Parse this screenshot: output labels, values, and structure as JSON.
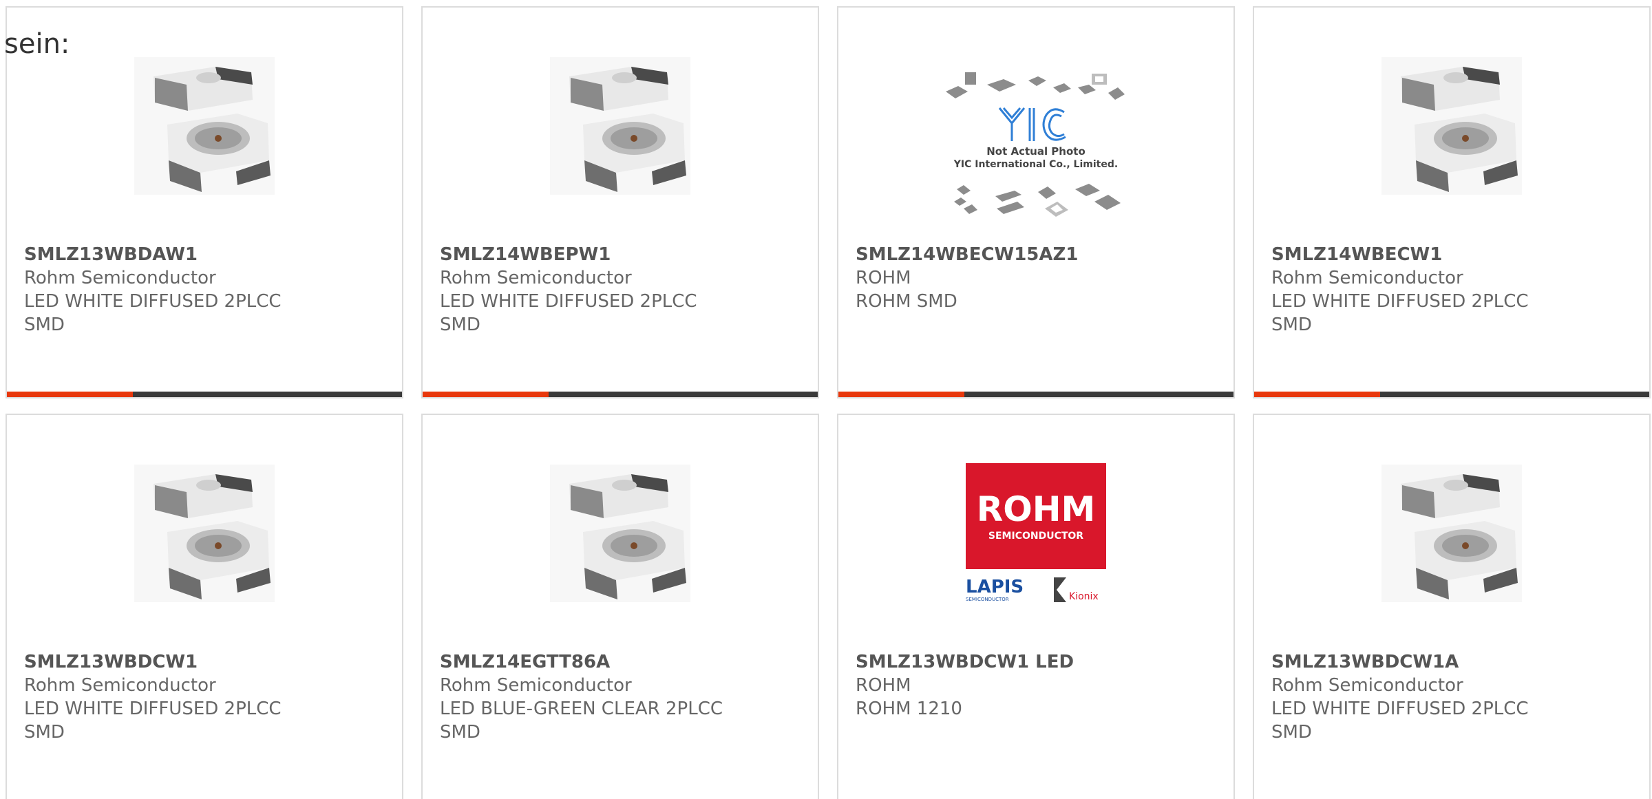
{
  "intro": {
    "text": "sein:"
  },
  "colors": {
    "accent": "#e8380d",
    "bar_dark": "#3a3a3a",
    "rohm_red": "#d9172b",
    "lapis_blue": "#1a4fa0",
    "yic_blue": "#2f7fd6"
  },
  "cards": [
    {
      "part": "SMLZ13WBDAW1",
      "maker": "Rohm Semiconductor",
      "desc1": "LED WHITE DIFFUSED 2PLCC",
      "desc2": "SMD",
      "image": "led-package-image"
    },
    {
      "part": "SMLZ14WBEPW1",
      "maker": "Rohm Semiconductor",
      "desc1": "LED WHITE DIFFUSED 2PLCC",
      "desc2": "SMD",
      "image": "led-package-image"
    },
    {
      "part": "SMLZ14WBECW15AZ1",
      "maker": "ROHM",
      "desc1": "ROHM SMD",
      "desc2": "",
      "image": "yic-placeholder-image",
      "yic_caption1": "Not Actual Photo",
      "yic_caption2": "YIC International Co., Limited.",
      "yic_logo": "YIC"
    },
    {
      "part": "SMLZ14WBECW1",
      "maker": "Rohm Semiconductor",
      "desc1": "LED WHITE DIFFUSED 2PLCC",
      "desc2": "SMD",
      "image": "led-package-image"
    },
    {
      "part": "SMLZ13WBDCW1",
      "maker": "Rohm Semiconductor",
      "desc1": "LED WHITE DIFFUSED 2PLCC",
      "desc2": "SMD",
      "image": "led-package-image"
    },
    {
      "part": "SMLZ14EGTT86A",
      "maker": "Rohm Semiconductor",
      "desc1": "LED BLUE-GREEN CLEAR 2PLCC",
      "desc2": "SMD",
      "image": "led-package-image"
    },
    {
      "part": "SMLZ13WBDCW1 LED",
      "maker": "ROHM",
      "desc1": "ROHM 1210",
      "desc2": "",
      "image": "rohm-logo-image",
      "logo_main": "ROHM",
      "logo_sub": "SEMICONDUCTOR",
      "logo_lapis": "LAPIS",
      "logo_lapis_sub": "SEMICONDUCTOR",
      "logo_kionix": "Kionix"
    },
    {
      "part": "SMLZ13WBDCW1A",
      "maker": "Rohm Semiconductor",
      "desc1": "LED WHITE DIFFUSED 2PLCC",
      "desc2": "SMD",
      "image": "led-package-image"
    }
  ]
}
